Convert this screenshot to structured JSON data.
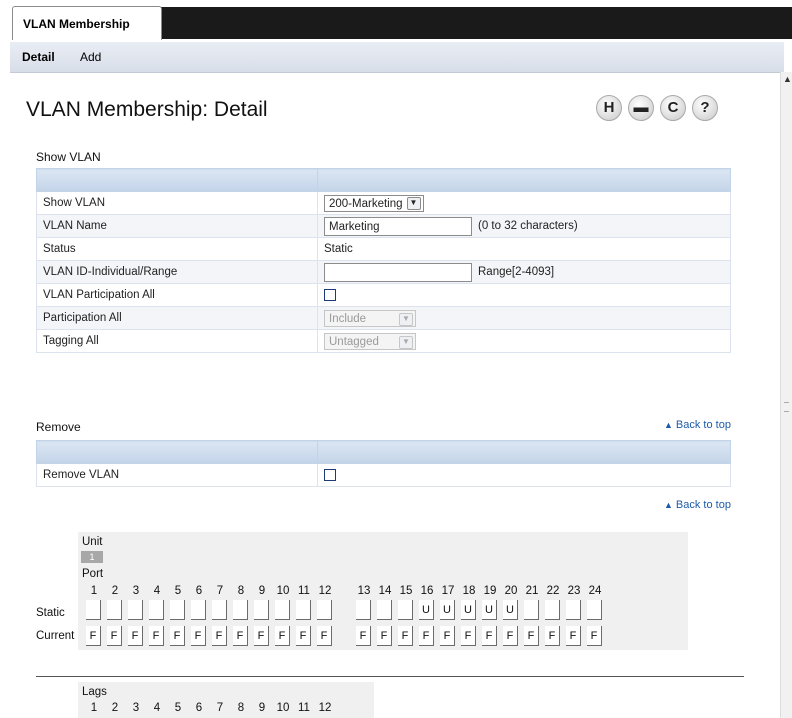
{
  "top_tab": "VLAN Membership",
  "subnav": [
    "Detail",
    "Add"
  ],
  "page_title": "VLAN Membership: Detail",
  "toolbar_icons": [
    "save-icon",
    "print-icon",
    "refresh-icon",
    "help-icon"
  ],
  "toolbar_glyphs": [
    "H",
    "▬",
    "C",
    "?"
  ],
  "show_vlan_section": {
    "title": "Show VLAN",
    "rows": {
      "show_vlan": {
        "label": "Show VLAN",
        "value": "200-Marketing"
      },
      "vlan_name": {
        "label": "VLAN Name",
        "value": "Marketing",
        "hint": "(0 to 32 characters)"
      },
      "status": {
        "label": "Status",
        "value": "Static"
      },
      "vlan_id": {
        "label": "VLAN ID-Individual/Range",
        "value": "",
        "hint": "Range[2-4093]"
      },
      "participation_all_check": {
        "label": "VLAN Participation All"
      },
      "participation_all": {
        "label": "Participation All",
        "value": "Include"
      },
      "tagging_all": {
        "label": "Tagging All",
        "value": "Untagged"
      }
    }
  },
  "remove_section": {
    "title": "Remove",
    "back_to_top": "Back to top",
    "remove_vlan_label": "Remove VLAN",
    "back_to_top_2": "Back to top"
  },
  "ports": {
    "unit_label": "Unit",
    "unit_value": "1",
    "port_label": "Port",
    "static_label": "Static",
    "current_label": "Current",
    "numbers": [
      "1",
      "2",
      "3",
      "4",
      "5",
      "6",
      "7",
      "8",
      "9",
      "10",
      "11",
      "12",
      "13",
      "14",
      "15",
      "16",
      "17",
      "18",
      "19",
      "20",
      "21",
      "22",
      "23",
      "24"
    ],
    "static": [
      "",
      "",
      "",
      "",
      "",
      "",
      "",
      "",
      "",
      "",
      "",
      "",
      "",
      "",
      "",
      "U",
      "U",
      "U",
      "U",
      "U",
      "",
      "",
      "",
      ""
    ],
    "current": [
      "F",
      "F",
      "F",
      "F",
      "F",
      "F",
      "F",
      "F",
      "F",
      "F",
      "F",
      "F",
      "F",
      "F",
      "F",
      "F",
      "F",
      "F",
      "F",
      "F",
      "F",
      "F",
      "F",
      "F"
    ]
  },
  "lags": {
    "label": "Lags",
    "numbers": [
      "1",
      "2",
      "3",
      "4",
      "5",
      "6",
      "7",
      "8",
      "9",
      "10",
      "11",
      "12"
    ]
  }
}
